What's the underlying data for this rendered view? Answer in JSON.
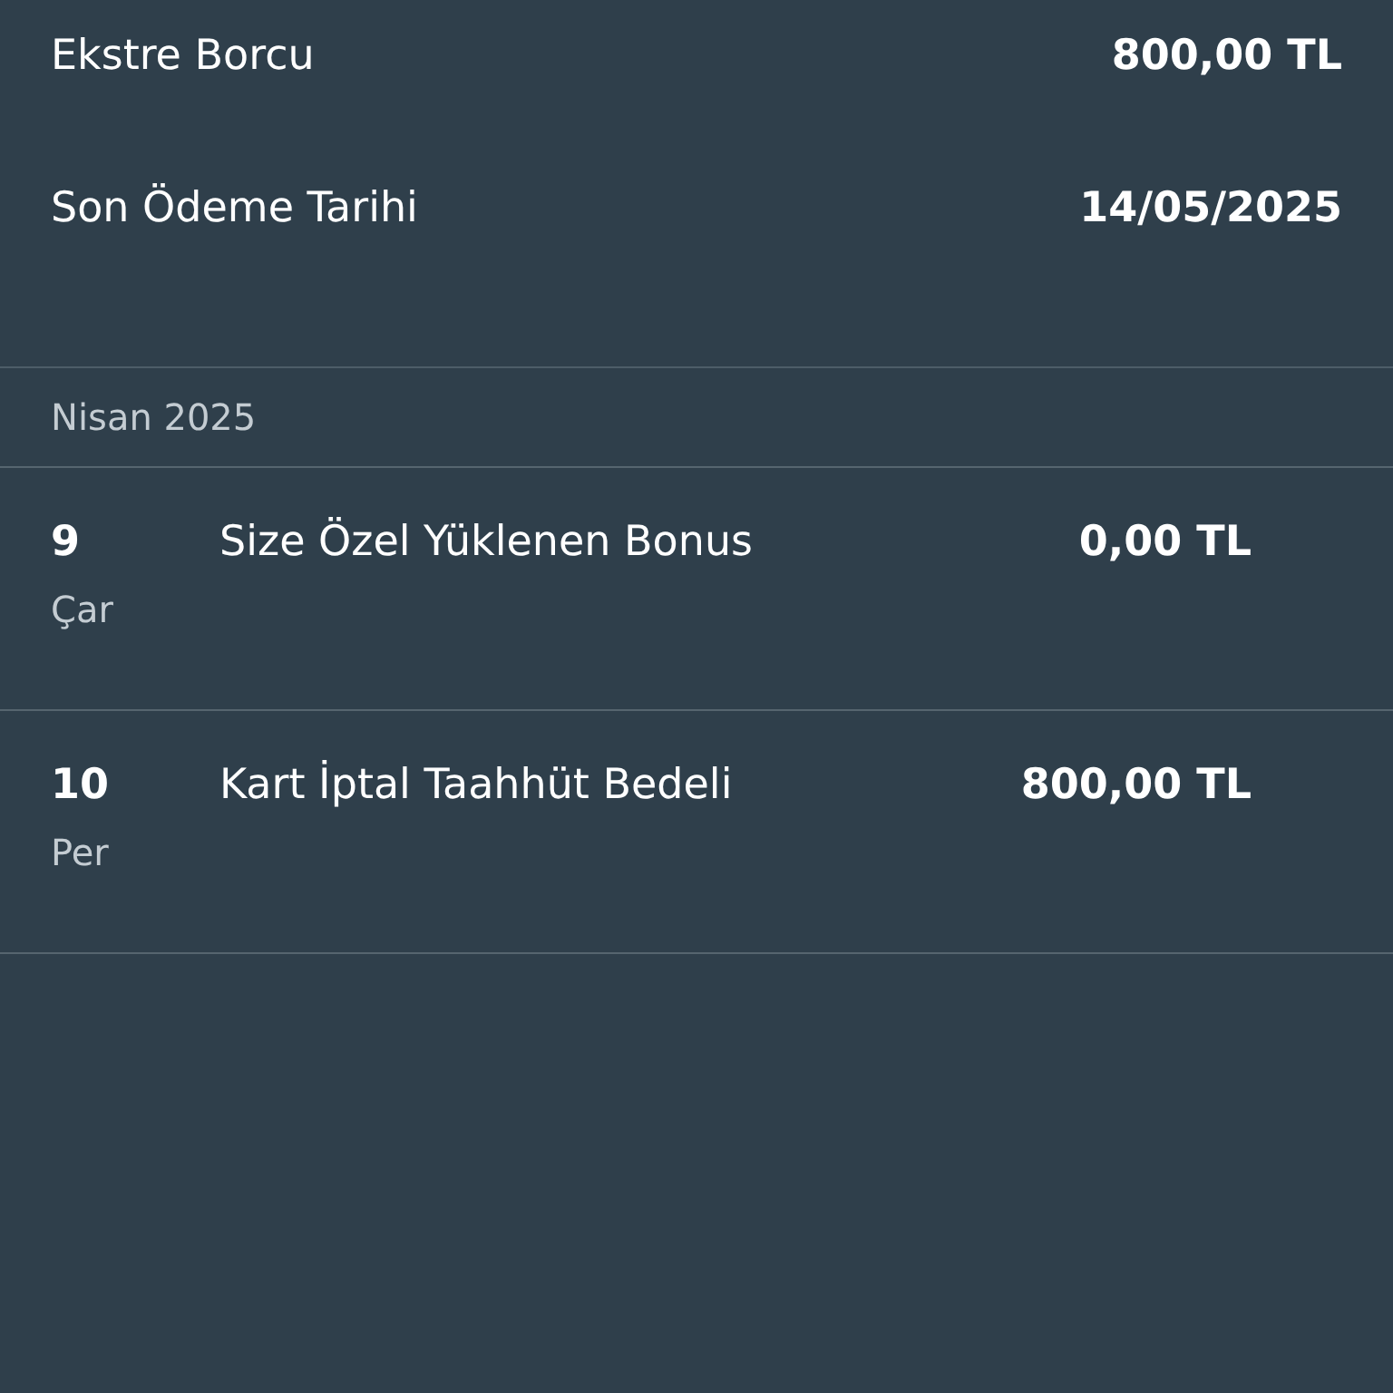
{
  "summary": [
    {
      "label": "Ekstre Borcu",
      "value": "800,00 TL"
    },
    {
      "label": "Son Ödeme Tarihi",
      "value": "14/05/2025"
    }
  ],
  "section": {
    "title": "Nisan 2025"
  },
  "transactions": [
    {
      "day": "9",
      "weekday": "Çar",
      "description": "Size Özel Yüklenen Bonus",
      "amount": "0,00 TL"
    },
    {
      "day": "10",
      "weekday": "Per",
      "description": "Kart İptal Taahhüt Bedeli",
      "amount": "800,00 TL"
    }
  ]
}
